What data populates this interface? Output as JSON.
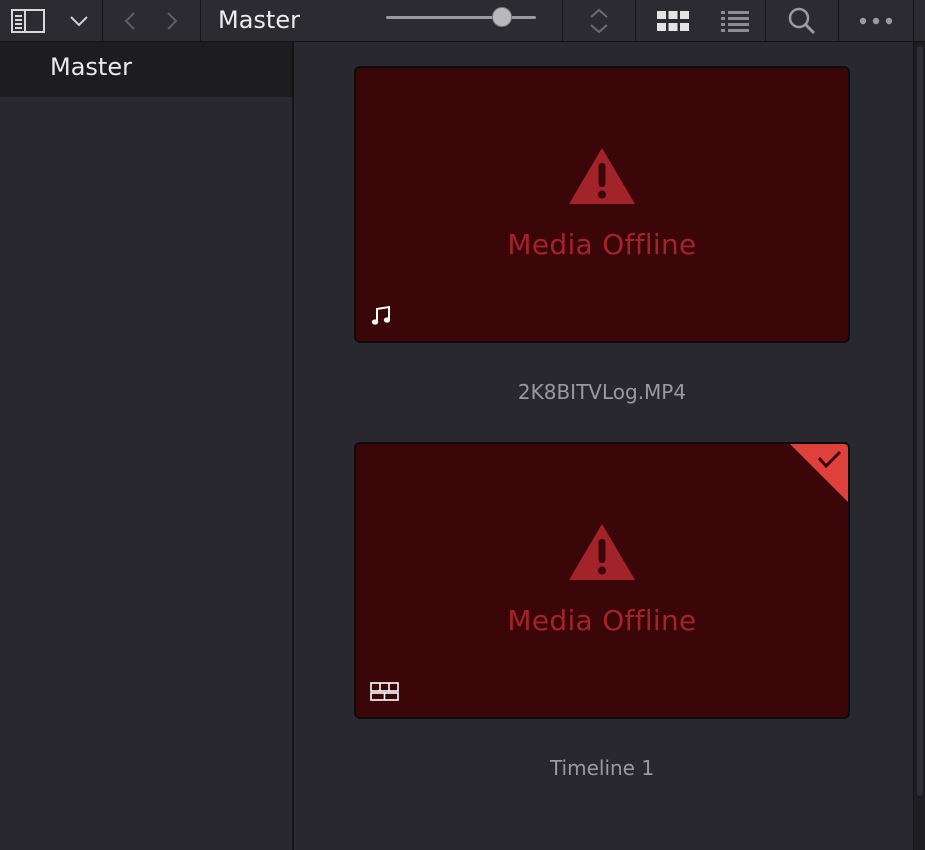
{
  "toolbar": {
    "title": "Master",
    "icons": [
      "panel-toggle-icon",
      "chevron-down-icon",
      "back-icon",
      "forward-icon",
      "sort-icon",
      "grid-view-icon",
      "list-view-icon",
      "search-icon",
      "more-icon"
    ],
    "zoom_level": 0.77
  },
  "sidebar": {
    "items": [
      {
        "label": "Master",
        "selected": true
      }
    ]
  },
  "clips": [
    {
      "name": "2K8BITVLog.MP4",
      "status": "Media Offline",
      "type_icon": "audio-note-icon",
      "flagged": false
    },
    {
      "name": "Timeline 1",
      "status": "Media Offline",
      "type_icon": "timeline-icon",
      "flagged": true
    }
  ],
  "colors": {
    "offline_bg": "#3a0608",
    "offline_text": "#a3232a",
    "flag": "#e0403c"
  }
}
